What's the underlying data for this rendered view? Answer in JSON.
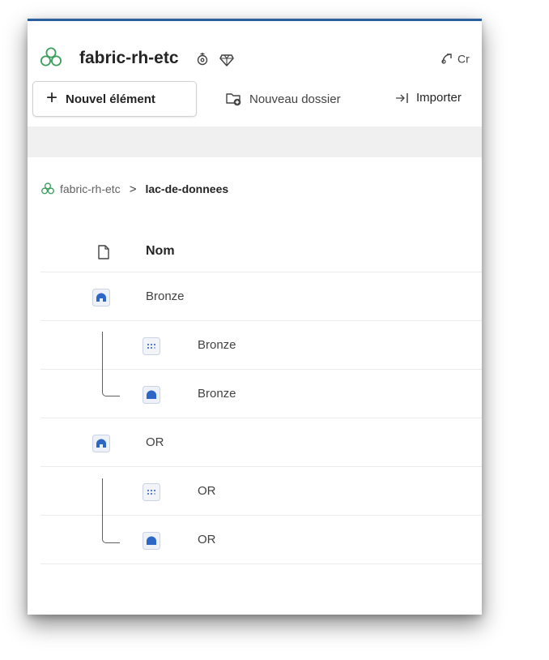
{
  "colors": {
    "accent": "#2a5f9e",
    "lakehouse_blue": "#2b67c7",
    "workspace_green": "#3a9f5c",
    "row_border": "#ebebeb",
    "band_gray": "#f0f0f0"
  },
  "header": {
    "workspace_icon": "workspace-icon",
    "title": "fabric-rh-etc",
    "icons": [
      "workspace-settings-icon",
      "premium-diamond-icon"
    ],
    "right_action": {
      "icon": "create-icon",
      "label": "Cr"
    }
  },
  "toolbar": {
    "new_item": {
      "icon": "plus-icon",
      "label": "Nouvel élément"
    },
    "new_folder": {
      "icon": "new-folder-icon",
      "label": "Nouveau dossier"
    },
    "import": {
      "icon": "import-icon",
      "label": "Importer"
    }
  },
  "breadcrumb": {
    "root_icon": "workspace-icon",
    "root": "fabric-rh-etc",
    "separator": ">",
    "current": "lac-de-donnees"
  },
  "table": {
    "columns": [
      {
        "icon": "file-type-icon",
        "label": "Nom"
      }
    ],
    "rows": [
      {
        "name": "Bronze",
        "icon": "lakehouse-icon",
        "level": 0
      },
      {
        "name": "Bronze",
        "icon": "sql-endpoint-icon",
        "level": 1
      },
      {
        "name": "Bronze",
        "icon": "semantic-model-icon",
        "level": 1
      },
      {
        "name": "OR",
        "icon": "lakehouse-icon",
        "level": 0
      },
      {
        "name": "OR",
        "icon": "sql-endpoint-icon",
        "level": 1
      },
      {
        "name": "OR",
        "icon": "semantic-model-icon",
        "level": 1
      }
    ]
  }
}
